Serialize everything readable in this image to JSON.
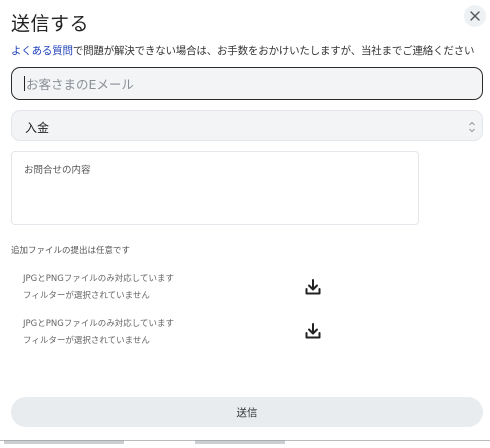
{
  "dialog": {
    "title": "送信する",
    "close_icon": "close-icon",
    "intro_link": "よくある質問",
    "intro_rest": "で問題が解決できない場合は、お手数をおかけいたしますが、当社までご連絡ください",
    "email_placeholder": "お客さまのEメール",
    "select_value": "入金",
    "message_placeholder": "お問合せの内容",
    "optional_note": "追加ファイルの提出は任意です",
    "files": [
      {
        "line1": "JPGとPNGファイルのみ対応しています",
        "line2": "フィルターが選択されていません"
      },
      {
        "line1": "JPGとPNGファイルのみ対応しています",
        "line2": "フィルターが選択されていません"
      }
    ],
    "submit_label": "送信"
  }
}
